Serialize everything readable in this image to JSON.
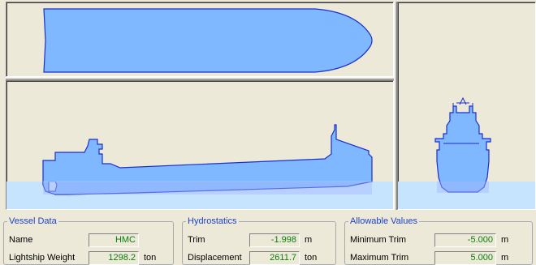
{
  "colors": {
    "hull_fill": "#7fb8ff",
    "hull_stroke": "#1a2fd0",
    "water": "#c7e4ff",
    "value_text": "#0a7d0a",
    "legend_text": "#1f3fc7"
  },
  "views": {
    "plan": "plan-view",
    "profile": "profile-view",
    "section": "body-section-view"
  },
  "vessel_data": {
    "legend": "Vessel Data",
    "name_label": "Name",
    "name_value": "HMC",
    "lightship_label": "Lightship Weight",
    "lightship_value": "1298.2",
    "lightship_unit": "ton"
  },
  "hydrostatics": {
    "legend": "Hydrostatics",
    "trim_label": "Trim",
    "trim_value": "-1.998",
    "trim_unit": "m",
    "disp_label": "Displacement",
    "disp_value": "2611.7",
    "disp_unit": "ton"
  },
  "allowable": {
    "legend": "Allowable Values",
    "min_trim_label": "Minimum Trim",
    "min_trim_value": "-5.000",
    "min_trim_unit": "m",
    "max_trim_label": "Maximum Trim",
    "max_trim_value": "5.000",
    "max_trim_unit": "m"
  }
}
